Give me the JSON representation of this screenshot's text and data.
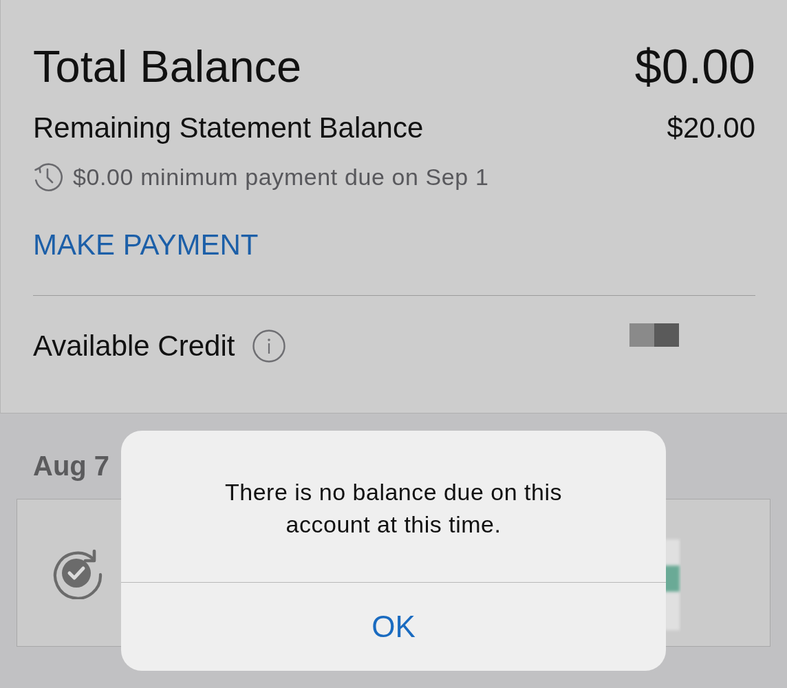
{
  "balance": {
    "title": "Total Balance",
    "amount": "$0.00"
  },
  "statement": {
    "label": "Remaining Statement Balance",
    "amount": "$20.00"
  },
  "minimum_due": {
    "text": "$0.00 minimum payment due on Sep 1"
  },
  "make_payment": {
    "label": "MAKE PAYMENT"
  },
  "available_credit": {
    "label": "Available Credit"
  },
  "activity": {
    "date": "Aug 7"
  },
  "alert": {
    "message": "There is no balance due on this account at this time.",
    "buttons": [
      "OK"
    ]
  }
}
